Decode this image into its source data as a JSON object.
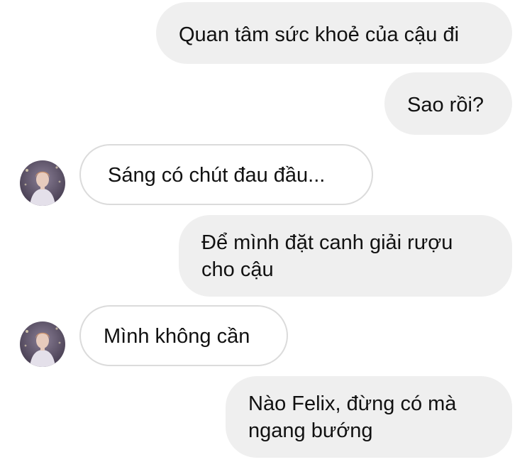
{
  "conversation": {
    "messages": [
      {
        "direction": "outgoing",
        "text": "Quan tâm sức khoẻ của cậu đi"
      },
      {
        "direction": "outgoing",
        "text": "Sao rồi?"
      },
      {
        "direction": "incoming",
        "text": "Sáng có chút đau đầu..."
      },
      {
        "direction": "outgoing",
        "text": " Để mình đặt canh giải rượu\ncho cậu"
      },
      {
        "direction": "incoming",
        "text": "Mình không cần"
      },
      {
        "direction": "outgoing",
        "text": " Nào Felix, đừng có mà\nngang bướng"
      }
    ]
  },
  "colors": {
    "outgoing_bubble": "#efefef",
    "incoming_border": "#dbdbdb",
    "text": "#111111"
  }
}
